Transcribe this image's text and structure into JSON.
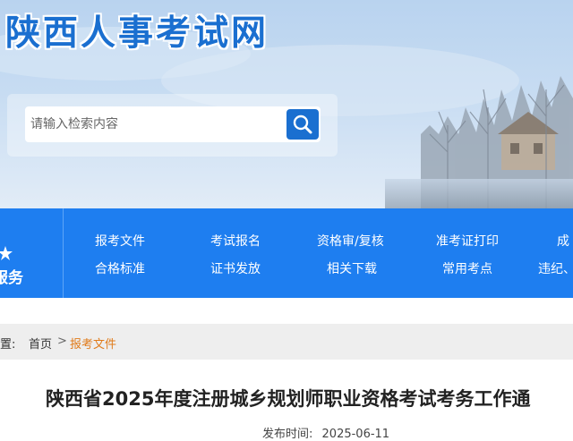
{
  "site": {
    "title": "陕西人事考试网"
  },
  "search": {
    "placeholder": "请输入检索内容"
  },
  "navbar": {
    "left_label": "服务",
    "items_row1": [
      "报考文件",
      "考试报名",
      "资格审/复核",
      "准考证打印",
      "成"
    ],
    "items_row2": [
      "合格标准",
      "证书发放",
      "相关下载",
      "常用考点",
      "违纪、"
    ]
  },
  "breadcrumb": {
    "prefix": "置:",
    "home": "首页",
    "separator": ">",
    "current": "报考文件"
  },
  "article": {
    "title": "陕西省2025年度注册城乡规划师职业资格考试考务工作通",
    "meta_label": "发布时间:",
    "date": "2025-06-11"
  },
  "colors": {
    "brand_blue": "#1e7ef0",
    "title_blue": "#1a6fd0",
    "breadcrumb_current": "#e07b1a"
  }
}
